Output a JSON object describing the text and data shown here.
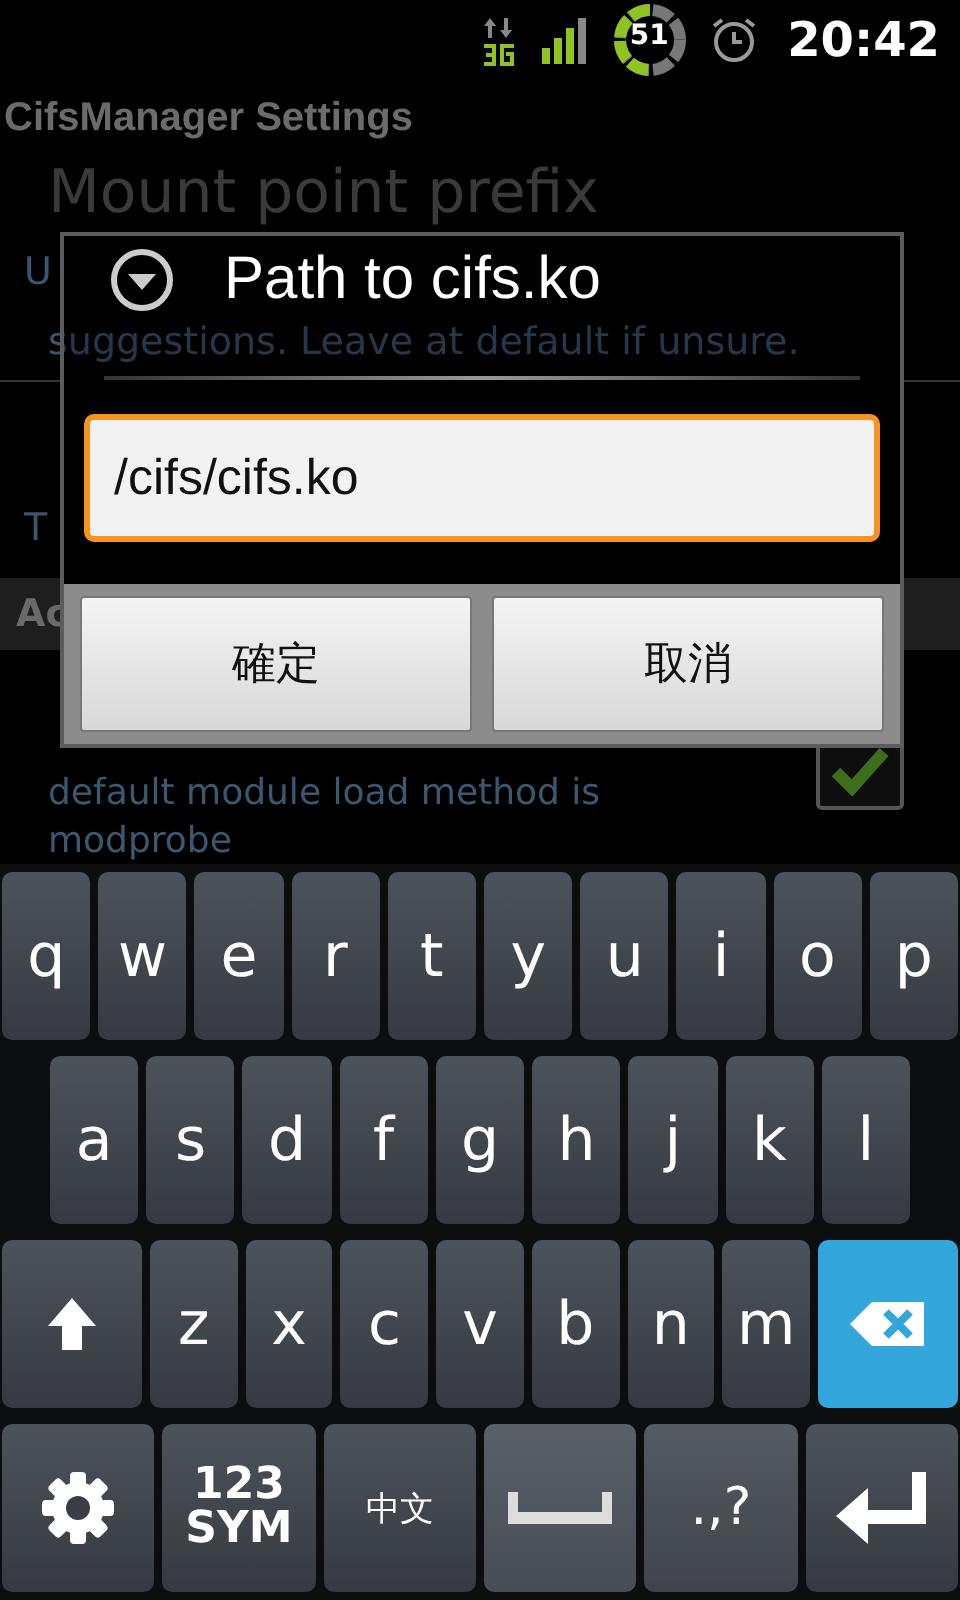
{
  "status_bar": {
    "battery": "51",
    "time": "20:42"
  },
  "app_title": "CifsManager Settings",
  "background": {
    "pref_title": "Mount point prefix",
    "pref_summary_start": "U",
    "pref_summary_line": "suggestions. Leave at default if unsure.",
    "item_fragment": "T",
    "category_fragment": "Ac",
    "checkbox_summary": "default module load method is modprobe",
    "checked": true
  },
  "dialog": {
    "title": "Path to cifs.ko",
    "value": "/cifs/cifs.ko",
    "buttons": [
      "確定",
      "取消"
    ]
  },
  "keyboard": {
    "rows": [
      {
        "keys": [
          {
            "kind": "letter",
            "label": "q"
          },
          {
            "kind": "letter",
            "label": "w"
          },
          {
            "kind": "letter",
            "label": "e"
          },
          {
            "kind": "letter",
            "label": "r"
          },
          {
            "kind": "letter",
            "label": "t"
          },
          {
            "kind": "letter",
            "label": "y"
          },
          {
            "kind": "letter",
            "label": "u"
          },
          {
            "kind": "letter",
            "label": "i"
          },
          {
            "kind": "letter",
            "label": "o"
          },
          {
            "kind": "letter",
            "label": "p"
          }
        ]
      },
      {
        "keys": [
          {
            "kind": "letter",
            "label": "a"
          },
          {
            "kind": "letter",
            "label": "s"
          },
          {
            "kind": "letter",
            "label": "d"
          },
          {
            "kind": "letter",
            "label": "f"
          },
          {
            "kind": "letter",
            "label": "g"
          },
          {
            "kind": "letter",
            "label": "h"
          },
          {
            "kind": "letter",
            "label": "j"
          },
          {
            "kind": "letter",
            "label": "k"
          },
          {
            "kind": "letter",
            "label": "l"
          }
        ]
      },
      {
        "keys": [
          {
            "kind": "shift"
          },
          {
            "kind": "letter",
            "label": "z"
          },
          {
            "kind": "letter",
            "label": "x"
          },
          {
            "kind": "letter",
            "label": "c"
          },
          {
            "kind": "letter",
            "label": "v"
          },
          {
            "kind": "letter",
            "label": "b"
          },
          {
            "kind": "letter",
            "label": "n"
          },
          {
            "kind": "letter",
            "label": "m"
          },
          {
            "kind": "delete"
          }
        ]
      },
      {
        "keys": [
          {
            "kind": "settings"
          },
          {
            "kind": "sym",
            "label": "123 SYM"
          },
          {
            "kind": "lang",
            "label": "中文"
          },
          {
            "kind": "space"
          },
          {
            "kind": "punct",
            "label": ".,?"
          },
          {
            "kind": "enter"
          }
        ]
      }
    ]
  }
}
